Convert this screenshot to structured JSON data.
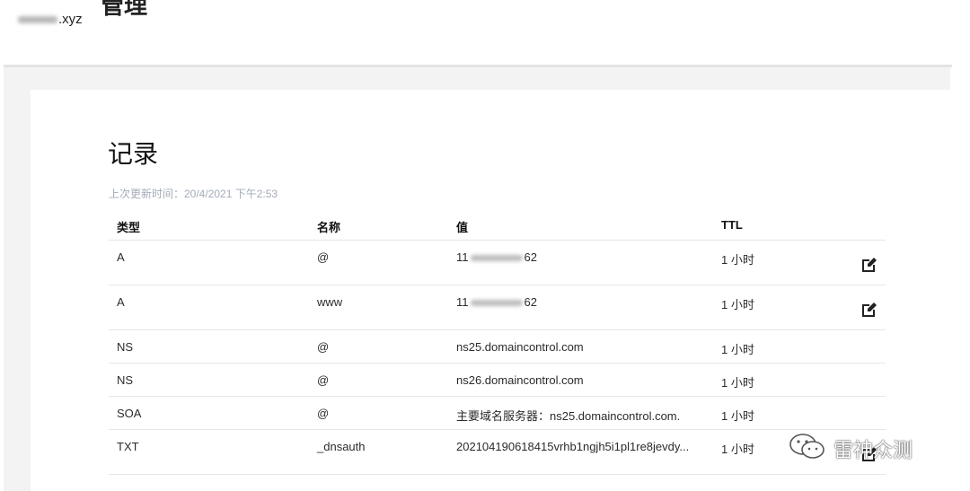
{
  "header": {
    "domain_suffix": ".xyz",
    "heading_stub": "管理"
  },
  "section": {
    "title": "记录",
    "last_updated": "上次更新时间：20/4/2021 下午2:53"
  },
  "table": {
    "columns": [
      "类型",
      "名称",
      "值",
      "TTL"
    ],
    "rows": [
      {
        "type": "A",
        "name": "@",
        "value_prefix": "11",
        "value_suffix": "62",
        "ttl": "1 小时",
        "editable": true
      },
      {
        "type": "A",
        "name": "www",
        "value_prefix": "11",
        "value_suffix": "62",
        "ttl": "1 小时",
        "editable": true
      },
      {
        "type": "NS",
        "name": "@",
        "value": "ns25.domaincontrol.com",
        "ttl": "1 小时",
        "editable": false
      },
      {
        "type": "NS",
        "name": "@",
        "value": "ns26.domaincontrol.com",
        "ttl": "1 小时",
        "editable": false
      },
      {
        "type": "SOA",
        "name": "@",
        "value": "主要域名服务器：ns25.domaincontrol.com.",
        "ttl": "1 小时",
        "editable": false
      },
      {
        "type": "TXT",
        "name": "_dnsauth",
        "value": "202104190618415vrhb1ngjh5i1pl1re8jevdy...",
        "ttl": "1 小时",
        "editable": true
      }
    ]
  },
  "icons": {
    "edit": "edit-icon",
    "watermark_logo": "wechat-icon"
  },
  "watermark": {
    "text": "雷神众测"
  }
}
